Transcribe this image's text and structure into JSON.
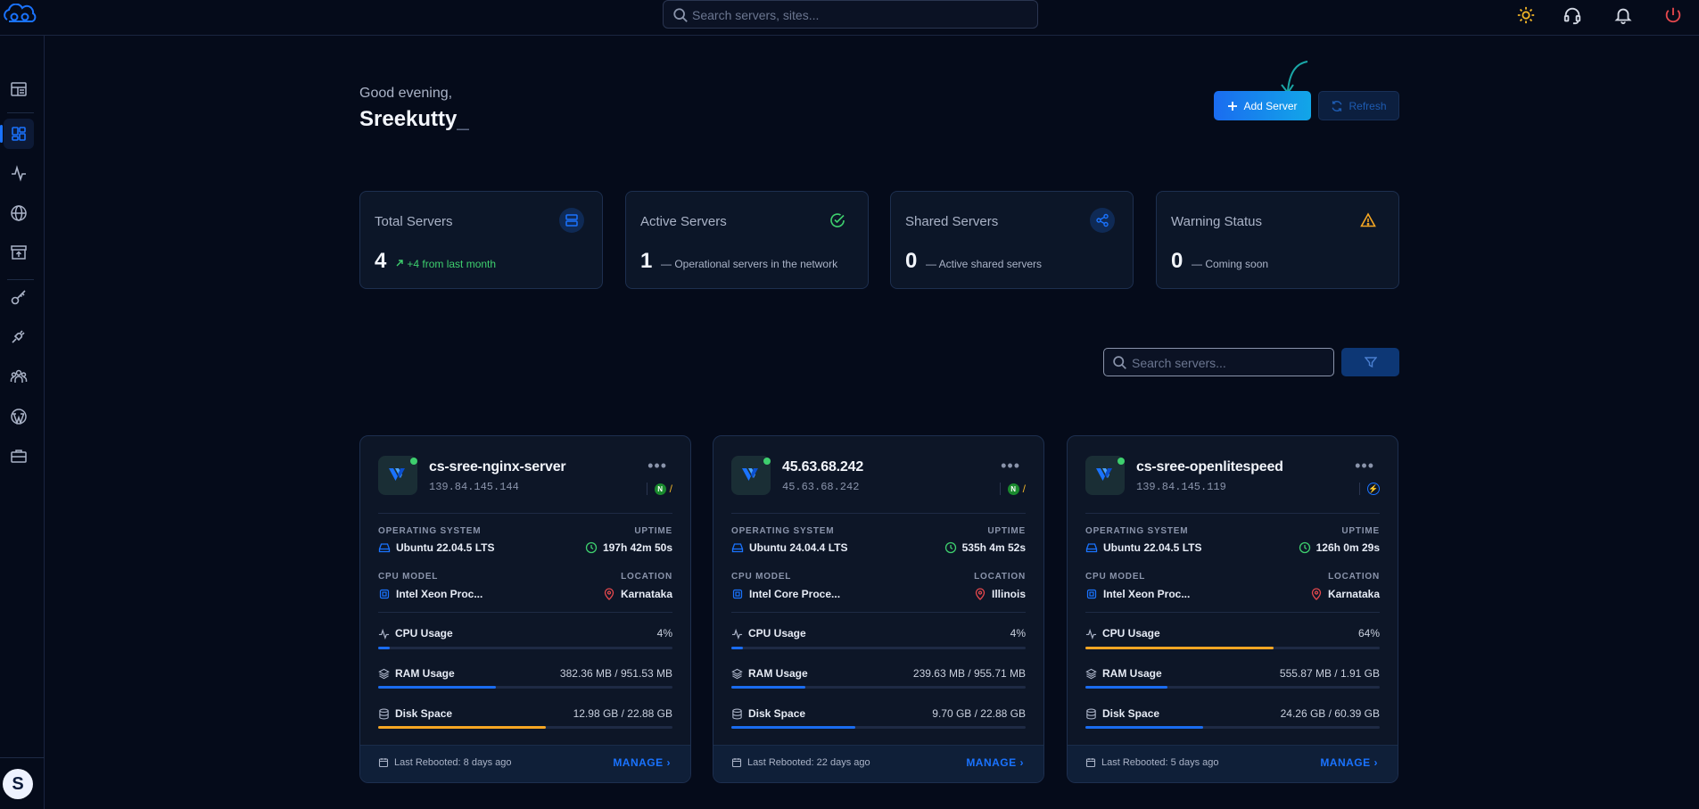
{
  "topbar": {
    "search_placeholder": "Search servers, sites...",
    "icons": [
      "theme-sun-icon",
      "support-headset-icon",
      "bell-icon",
      "power-icon"
    ]
  },
  "sidebar": {
    "items": [
      {
        "icon": "dashboard-layout-icon"
      },
      {
        "icon": "servers-grid-icon",
        "active": true
      },
      {
        "icon": "activity-icon"
      },
      {
        "icon": "globe-icon"
      },
      {
        "icon": "archive-upload-icon"
      },
      {
        "icon": "key-icon"
      },
      {
        "icon": "plug-icon"
      },
      {
        "icon": "team-icon"
      },
      {
        "icon": "wordpress-icon"
      },
      {
        "icon": "briefcase-icon"
      }
    ],
    "avatar_initial": "S"
  },
  "header": {
    "greeting": "Good evening,",
    "username": "Sreekutty",
    "cursor": "_",
    "add_server_label": "Add Server",
    "refresh_label": "Refresh"
  },
  "stats": [
    {
      "label": "Total Servers",
      "value": "4",
      "sub": "+4 from last month",
      "icon": "server-stack-icon"
    },
    {
      "label": "Active Servers",
      "value": "1",
      "sub": "Operational servers in the network",
      "icon": "check-circle-icon"
    },
    {
      "label": "Shared Servers",
      "value": "0",
      "sub": "Active shared servers",
      "icon": "share-icon"
    },
    {
      "label": "Warning Status",
      "value": "0",
      "sub": "Coming soon",
      "icon": "warning-triangle-icon"
    }
  ],
  "list": {
    "search_placeholder": "Search servers...",
    "filter_icon": "filter-icon"
  },
  "servers": [
    {
      "name": "cs-sree-nginx-server",
      "ip": "139.84.145.144",
      "os_label": "OPERATING SYSTEM",
      "os": "Ubuntu 22.04.5 LTS",
      "uptime_label": "UPTIME",
      "uptime": "197h 42m 50s",
      "cpu_model_label": "CPU MODEL",
      "cpu_model": "Intel Xeon Proc...",
      "location_label": "LOCATION",
      "location": "Karnataka",
      "cpu_label": "CPU Usage",
      "cpu_value": "4%",
      "cpu_pct": 4,
      "ram_label": "RAM Usage",
      "ram_value": "382.36 MB / 951.53 MB",
      "ram_pct": 40,
      "disk_label": "Disk Space",
      "disk_value": "12.98 GB / 22.88 GB",
      "disk_pct": 57,
      "last_rebooted": "Last Rebooted: 8 days ago",
      "manage": "MANAGE",
      "stack": "nginx"
    },
    {
      "name": "45.63.68.242",
      "ip": "45.63.68.242",
      "os_label": "OPERATING SYSTEM",
      "os": "Ubuntu 24.04.4 LTS",
      "uptime_label": "UPTIME",
      "uptime": "535h 4m 52s",
      "cpu_model_label": "CPU MODEL",
      "cpu_model": "Intel Core Proce...",
      "location_label": "LOCATION",
      "location": "Illinois",
      "cpu_label": "CPU Usage",
      "cpu_value": "4%",
      "cpu_pct": 4,
      "ram_label": "RAM Usage",
      "ram_value": "239.63 MB / 955.71 MB",
      "ram_pct": 25,
      "disk_label": "Disk Space",
      "disk_value": "9.70 GB / 22.88 GB",
      "disk_pct": 42,
      "last_rebooted": "Last Rebooted: 22 days ago",
      "manage": "MANAGE",
      "stack": "nginx"
    },
    {
      "name": "cs-sree-openlitespeed",
      "ip": "139.84.145.119",
      "os_label": "OPERATING SYSTEM",
      "os": "Ubuntu 22.04.5 LTS",
      "uptime_label": "UPTIME",
      "uptime": "126h 0m 29s",
      "cpu_model_label": "CPU MODEL",
      "cpu_model": "Intel Xeon Proc...",
      "location_label": "LOCATION",
      "location": "Karnataka",
      "cpu_label": "CPU Usage",
      "cpu_value": "64%",
      "cpu_pct": 64,
      "ram_label": "RAM Usage",
      "ram_value": "555.87 MB / 1.91 GB",
      "ram_pct": 28,
      "disk_label": "Disk Space",
      "disk_value": "24.26 GB / 60.39 GB",
      "disk_pct": 40,
      "last_rebooted": "Last Rebooted: 5 days ago",
      "manage": "MANAGE",
      "stack": "openlitespeed"
    }
  ],
  "colors": {
    "background": "#050b1a",
    "card": "#0d1627",
    "accent": "#1a73ff",
    "success": "#3ecf6e",
    "warning": "#f5a623",
    "danger": "#e5484d"
  }
}
